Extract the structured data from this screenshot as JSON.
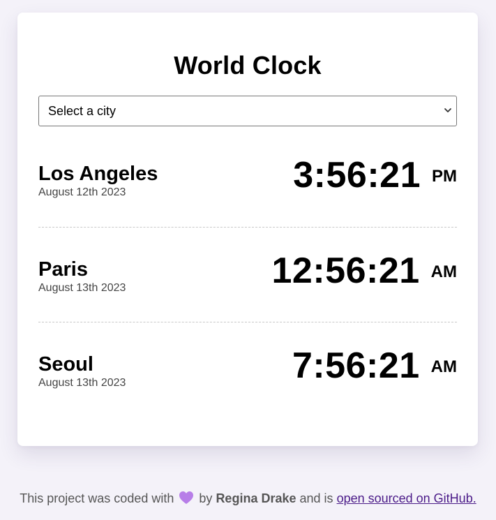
{
  "app": {
    "title": "World Clock"
  },
  "city_select": {
    "selected": "Select a city",
    "options": [
      "Select a city"
    ]
  },
  "cities": [
    {
      "name": "Los Angeles",
      "date": "August 12th 2023",
      "time": "3:56:21",
      "ampm": "PM"
    },
    {
      "name": "Paris",
      "date": "August 13th 2023",
      "time": "12:56:21",
      "ampm": "AM"
    },
    {
      "name": "Seoul",
      "date": "August 13th 2023",
      "time": "7:56:21",
      "ampm": "AM"
    }
  ],
  "footer": {
    "text_before": "This project was coded with",
    "heart_icon": "purple-heart-icon",
    "text_by": "by",
    "author": "Regina Drake",
    "text_and": "and is",
    "link_text": "open sourced on GitHub."
  },
  "colors": {
    "background": "#f4f2f9",
    "card": "#ffffff",
    "heart": "#b77ee8",
    "link": "#4a1a88"
  }
}
